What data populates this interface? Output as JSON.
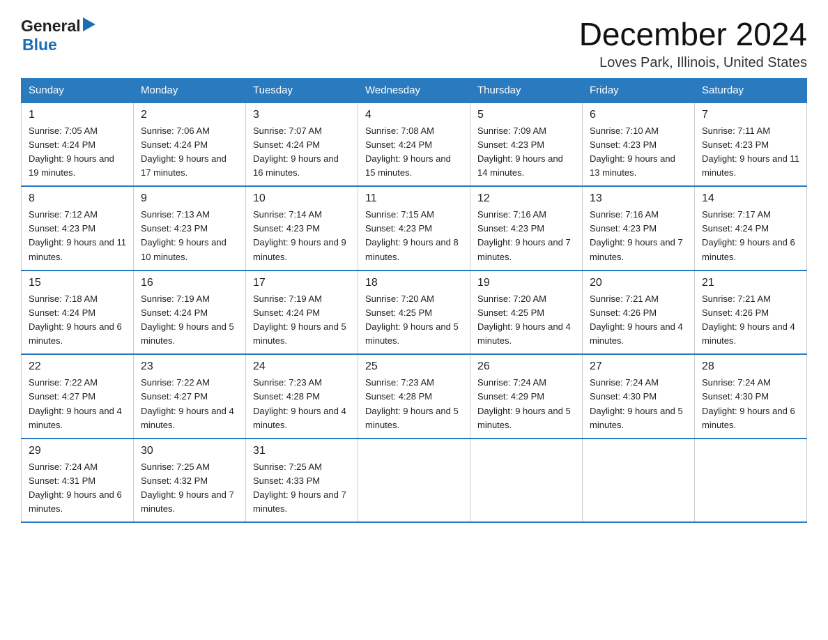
{
  "logo": {
    "general": "General",
    "blue": "Blue"
  },
  "title": "December 2024",
  "location": "Loves Park, Illinois, United States",
  "days_of_week": [
    "Sunday",
    "Monday",
    "Tuesday",
    "Wednesday",
    "Thursday",
    "Friday",
    "Saturday"
  ],
  "weeks": [
    [
      {
        "num": "1",
        "sunrise": "Sunrise: 7:05 AM",
        "sunset": "Sunset: 4:24 PM",
        "daylight": "Daylight: 9 hours and 19 minutes."
      },
      {
        "num": "2",
        "sunrise": "Sunrise: 7:06 AM",
        "sunset": "Sunset: 4:24 PM",
        "daylight": "Daylight: 9 hours and 17 minutes."
      },
      {
        "num": "3",
        "sunrise": "Sunrise: 7:07 AM",
        "sunset": "Sunset: 4:24 PM",
        "daylight": "Daylight: 9 hours and 16 minutes."
      },
      {
        "num": "4",
        "sunrise": "Sunrise: 7:08 AM",
        "sunset": "Sunset: 4:24 PM",
        "daylight": "Daylight: 9 hours and 15 minutes."
      },
      {
        "num": "5",
        "sunrise": "Sunrise: 7:09 AM",
        "sunset": "Sunset: 4:23 PM",
        "daylight": "Daylight: 9 hours and 14 minutes."
      },
      {
        "num": "6",
        "sunrise": "Sunrise: 7:10 AM",
        "sunset": "Sunset: 4:23 PM",
        "daylight": "Daylight: 9 hours and 13 minutes."
      },
      {
        "num": "7",
        "sunrise": "Sunrise: 7:11 AM",
        "sunset": "Sunset: 4:23 PM",
        "daylight": "Daylight: 9 hours and 11 minutes."
      }
    ],
    [
      {
        "num": "8",
        "sunrise": "Sunrise: 7:12 AM",
        "sunset": "Sunset: 4:23 PM",
        "daylight": "Daylight: 9 hours and 11 minutes."
      },
      {
        "num": "9",
        "sunrise": "Sunrise: 7:13 AM",
        "sunset": "Sunset: 4:23 PM",
        "daylight": "Daylight: 9 hours and 10 minutes."
      },
      {
        "num": "10",
        "sunrise": "Sunrise: 7:14 AM",
        "sunset": "Sunset: 4:23 PM",
        "daylight": "Daylight: 9 hours and 9 minutes."
      },
      {
        "num": "11",
        "sunrise": "Sunrise: 7:15 AM",
        "sunset": "Sunset: 4:23 PM",
        "daylight": "Daylight: 9 hours and 8 minutes."
      },
      {
        "num": "12",
        "sunrise": "Sunrise: 7:16 AM",
        "sunset": "Sunset: 4:23 PM",
        "daylight": "Daylight: 9 hours and 7 minutes."
      },
      {
        "num": "13",
        "sunrise": "Sunrise: 7:16 AM",
        "sunset": "Sunset: 4:23 PM",
        "daylight": "Daylight: 9 hours and 7 minutes."
      },
      {
        "num": "14",
        "sunrise": "Sunrise: 7:17 AM",
        "sunset": "Sunset: 4:24 PM",
        "daylight": "Daylight: 9 hours and 6 minutes."
      }
    ],
    [
      {
        "num": "15",
        "sunrise": "Sunrise: 7:18 AM",
        "sunset": "Sunset: 4:24 PM",
        "daylight": "Daylight: 9 hours and 6 minutes."
      },
      {
        "num": "16",
        "sunrise": "Sunrise: 7:19 AM",
        "sunset": "Sunset: 4:24 PM",
        "daylight": "Daylight: 9 hours and 5 minutes."
      },
      {
        "num": "17",
        "sunrise": "Sunrise: 7:19 AM",
        "sunset": "Sunset: 4:24 PM",
        "daylight": "Daylight: 9 hours and 5 minutes."
      },
      {
        "num": "18",
        "sunrise": "Sunrise: 7:20 AM",
        "sunset": "Sunset: 4:25 PM",
        "daylight": "Daylight: 9 hours and 5 minutes."
      },
      {
        "num": "19",
        "sunrise": "Sunrise: 7:20 AM",
        "sunset": "Sunset: 4:25 PM",
        "daylight": "Daylight: 9 hours and 4 minutes."
      },
      {
        "num": "20",
        "sunrise": "Sunrise: 7:21 AM",
        "sunset": "Sunset: 4:26 PM",
        "daylight": "Daylight: 9 hours and 4 minutes."
      },
      {
        "num": "21",
        "sunrise": "Sunrise: 7:21 AM",
        "sunset": "Sunset: 4:26 PM",
        "daylight": "Daylight: 9 hours and 4 minutes."
      }
    ],
    [
      {
        "num": "22",
        "sunrise": "Sunrise: 7:22 AM",
        "sunset": "Sunset: 4:27 PM",
        "daylight": "Daylight: 9 hours and 4 minutes."
      },
      {
        "num": "23",
        "sunrise": "Sunrise: 7:22 AM",
        "sunset": "Sunset: 4:27 PM",
        "daylight": "Daylight: 9 hours and 4 minutes."
      },
      {
        "num": "24",
        "sunrise": "Sunrise: 7:23 AM",
        "sunset": "Sunset: 4:28 PM",
        "daylight": "Daylight: 9 hours and 4 minutes."
      },
      {
        "num": "25",
        "sunrise": "Sunrise: 7:23 AM",
        "sunset": "Sunset: 4:28 PM",
        "daylight": "Daylight: 9 hours and 5 minutes."
      },
      {
        "num": "26",
        "sunrise": "Sunrise: 7:24 AM",
        "sunset": "Sunset: 4:29 PM",
        "daylight": "Daylight: 9 hours and 5 minutes."
      },
      {
        "num": "27",
        "sunrise": "Sunrise: 7:24 AM",
        "sunset": "Sunset: 4:30 PM",
        "daylight": "Daylight: 9 hours and 5 minutes."
      },
      {
        "num": "28",
        "sunrise": "Sunrise: 7:24 AM",
        "sunset": "Sunset: 4:30 PM",
        "daylight": "Daylight: 9 hours and 6 minutes."
      }
    ],
    [
      {
        "num": "29",
        "sunrise": "Sunrise: 7:24 AM",
        "sunset": "Sunset: 4:31 PM",
        "daylight": "Daylight: 9 hours and 6 minutes."
      },
      {
        "num": "30",
        "sunrise": "Sunrise: 7:25 AM",
        "sunset": "Sunset: 4:32 PM",
        "daylight": "Daylight: 9 hours and 7 minutes."
      },
      {
        "num": "31",
        "sunrise": "Sunrise: 7:25 AM",
        "sunset": "Sunset: 4:33 PM",
        "daylight": "Daylight: 9 hours and 7 minutes."
      },
      null,
      null,
      null,
      null
    ]
  ]
}
